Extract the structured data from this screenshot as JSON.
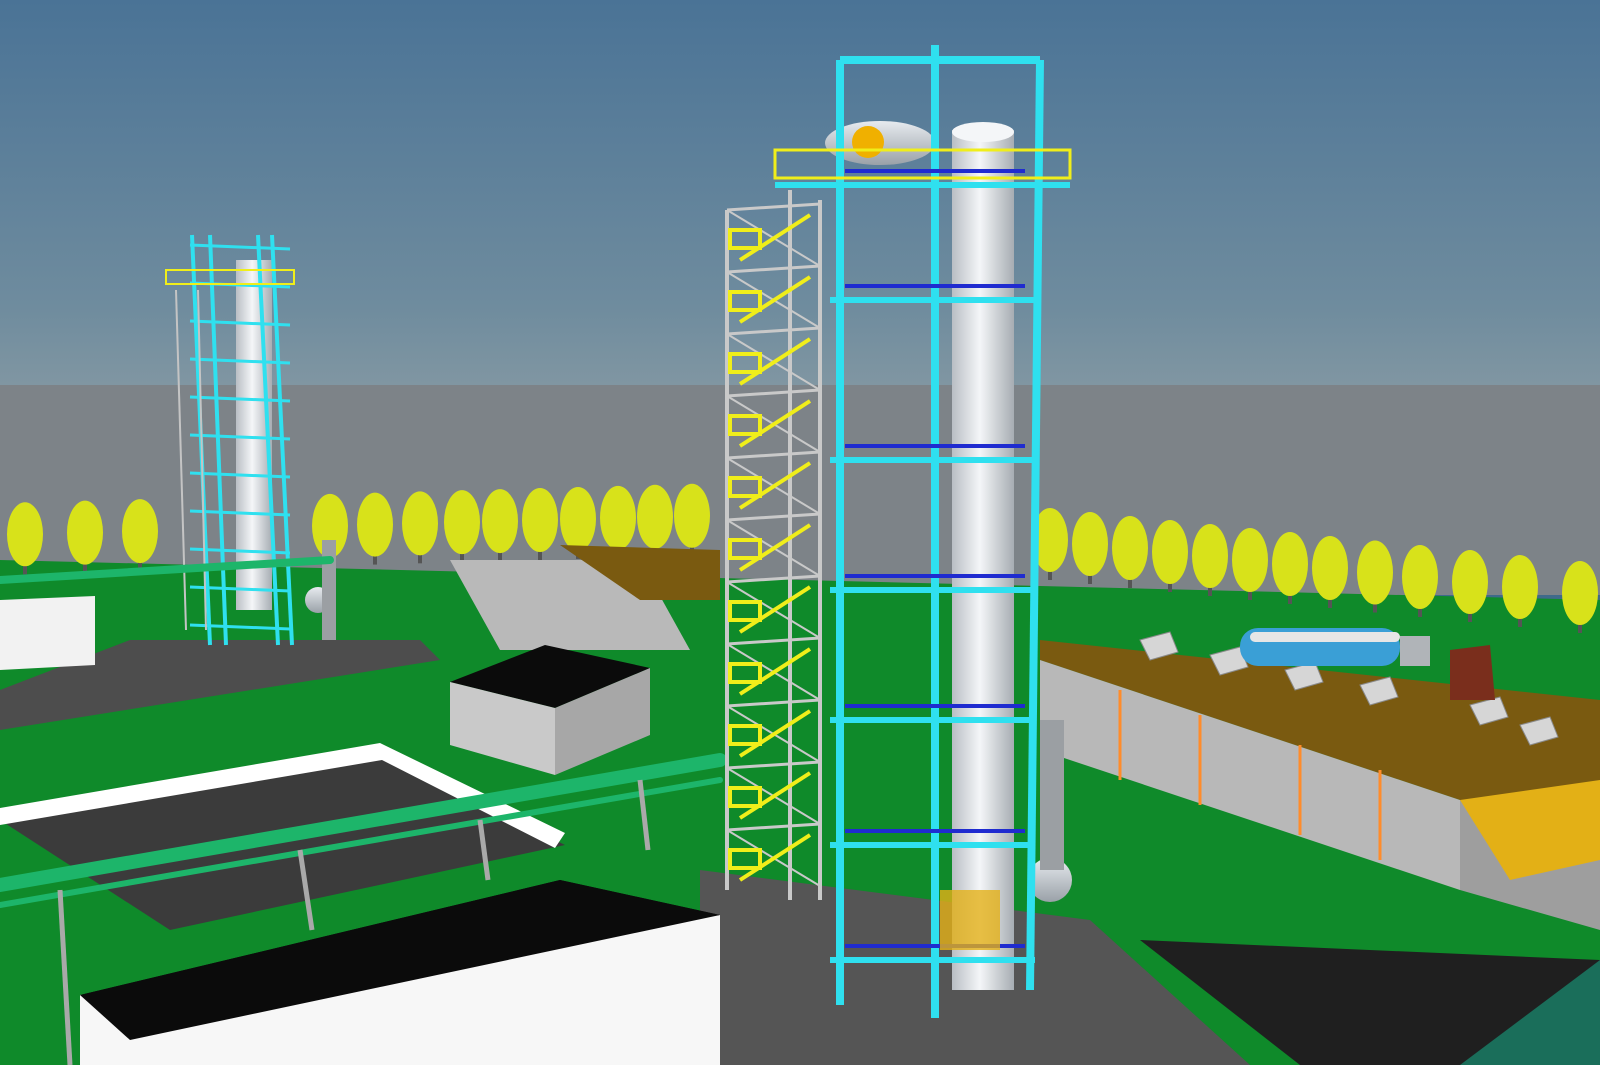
{
  "scene": {
    "kind": "3D CAD render of an industrial distillation plant",
    "colors": {
      "sky_top": "#4a7396",
      "sky_bottom": "#8096a2",
      "horizon": "#7d8388",
      "ground": "#0f8a2a",
      "road": "#4a4a4a",
      "tower_frame": "#2fe0ef",
      "stair_frame": "#c9c9c9",
      "handrail": "#f0ee1a",
      "column": "#e4e8ec",
      "pipe": "#1db56a",
      "tree": "#d8e21a",
      "basin_fill": "#7a5a10",
      "building_roof": "#0b0b0b",
      "building_wall": "#f2f2f2"
    }
  }
}
